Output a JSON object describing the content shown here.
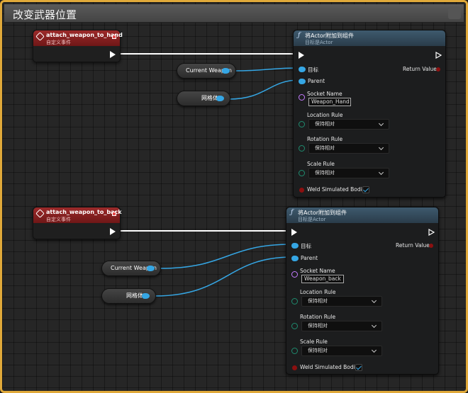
{
  "comment": {
    "title": "改变武器位置"
  },
  "colors": {
    "frame": "#e0a93a",
    "event_head": "#9c2a2a",
    "object_pin": "#35a6e4",
    "name_pin": "#c57bff",
    "enum_pin": "#1f8c6f",
    "bool_pin": "#8c1010"
  },
  "event_nodes": [
    {
      "title": "attach_weapon_to_hand",
      "subtitle": "自定义事件"
    },
    {
      "title": "attach_weapon_to_back",
      "subtitle": "自定义事件"
    }
  ],
  "variables": [
    {
      "label": "Current Weapon"
    },
    {
      "label": "网格体"
    },
    {
      "label": "Current Weapon"
    },
    {
      "label": "网格体"
    }
  ],
  "functions": [
    {
      "title": "将Actor附加到组件",
      "subtitle": "目标是Actor",
      "pins": {
        "target": "目标",
        "parent": "Parent",
        "return": "Return Value",
        "socket_name": "Socket Name",
        "socket_value": "Weapon_Hand",
        "location_rule": "Location Rule",
        "location_value": "保持相对",
        "rotation_rule": "Rotation Rule",
        "rotation_value": "保持相对",
        "scale_rule": "Scale Rule",
        "scale_value": "保持相对",
        "weld": "Weld Simulated Bodies",
        "weld_checked": true
      }
    },
    {
      "title": "将Actor附加到组件",
      "subtitle": "目标是Actor",
      "pins": {
        "target": "目标",
        "parent": "Parent",
        "return": "Return Value",
        "socket_name": "Socket Name",
        "socket_value": "Weapon_back",
        "location_rule": "Location Rule",
        "location_value": "保持相对",
        "rotation_rule": "Rotation Rule",
        "rotation_value": "保持相对",
        "scale_rule": "Scale Rule",
        "scale_value": "保持相对",
        "weld": "Weld Simulated Bodies",
        "weld_checked": true
      }
    }
  ]
}
